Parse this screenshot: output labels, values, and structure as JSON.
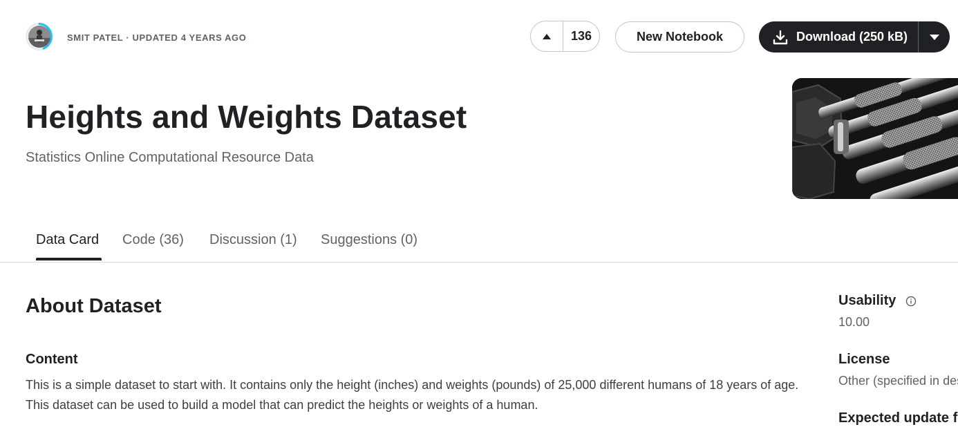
{
  "header": {
    "owner_meta": "SMIT PATEL · UPDATED 4 YEARS AGO",
    "vote_count": "136",
    "new_notebook_label": "New Notebook",
    "download_label": "Download (250 kB)"
  },
  "dataset": {
    "title": "Heights and Weights Dataset",
    "subtitle": "Statistics Online Computational Resource Data"
  },
  "tabs": [
    {
      "label": "Data Card",
      "active": true
    },
    {
      "label": "Code (36)"
    },
    {
      "label": "Discussion (1)"
    },
    {
      "label": "Suggestions (0)"
    }
  ],
  "about": {
    "heading": "About Dataset",
    "content_heading": "Content",
    "content_text": "This is a simple dataset to start with. It contains only the height (inches) and weights (pounds) of 25,000 different humans of 18 years of age. This dataset can be used to build a model that can predict the heights or weights of a human."
  },
  "sidebar": {
    "usability_label": "Usability",
    "usability_value": "10.00",
    "license_label": "License",
    "license_value": "Other (specified in description)",
    "expected_update_label": "Expected update frequency"
  },
  "icons": {
    "upvote": "caret-up-icon",
    "download": "download-icon",
    "dropdown": "caret-down-icon",
    "info": "info-icon"
  },
  "colors": {
    "primary_dark": "#202124",
    "text_secondary": "#5f6368",
    "border": "#c4c7c5",
    "avatar_ring": "#20beff"
  }
}
